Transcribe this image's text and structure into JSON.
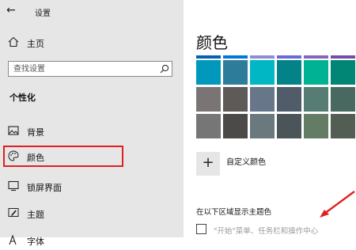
{
  "window": {
    "title": "设置"
  },
  "sidebar": {
    "home_label": "主页",
    "search_placeholder": "查找设置",
    "section_title": "个性化",
    "items": [
      {
        "label": "背景",
        "icon": "image-icon"
      },
      {
        "label": "颜色",
        "icon": "palette-icon",
        "selected": true
      },
      {
        "label": "锁屏界面",
        "icon": "lock-screen-icon"
      },
      {
        "label": "主题",
        "icon": "theme-brush-icon"
      },
      {
        "label": "字体",
        "icon": "font-icon"
      }
    ]
  },
  "main": {
    "title": "颜色",
    "swatch_rows": [
      [
        "#0099bc",
        "#2d7d9a",
        "#00b7c3",
        "#038387",
        "#00b294",
        "#018574"
      ],
      [
        "#7a7574",
        "#5d5a58",
        "#68768a",
        "#515c6b",
        "#567c73",
        "#486860"
      ],
      [
        "#767676",
        "#4c4a48",
        "#69797e",
        "#4a5459",
        "#647c64",
        "#525e54"
      ]
    ],
    "top_strip_colors": [
      "#0063b1",
      "#0078d7",
      "#8e8cd8",
      "#6b69d6",
      "#8764b8",
      "#744da9"
    ],
    "custom_color_label": "自定义颜色",
    "theme_section_heading": "在以下区域显示主题色",
    "checkbox_label": "\"开始\"菜单、任务栏和操作中心",
    "checkbox_checked": false
  },
  "colors": {
    "annotation_red": "#e02020",
    "sidebar_bg": "#e6e6e6"
  }
}
